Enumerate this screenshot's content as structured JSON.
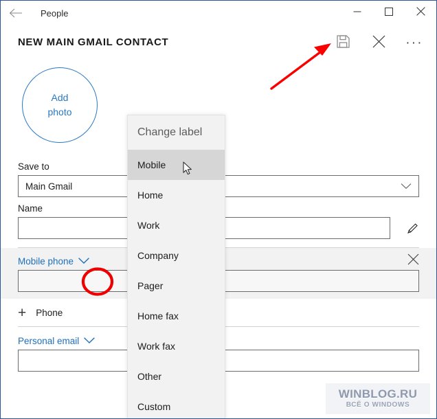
{
  "window": {
    "title": "People",
    "back_icon": "back-arrow-icon",
    "minimize": "–",
    "maximize": "□",
    "close": "✕"
  },
  "command_bar": {
    "page_title": "NEW MAIN GMAIL CONTACT",
    "save_icon": "save-floppy-icon",
    "cancel_icon": "close-x-icon",
    "more_icon": "more-ellipsis-icon",
    "more_glyph": "···"
  },
  "avatar": {
    "line1": "Add",
    "line2": "photo"
  },
  "form": {
    "save_to": {
      "label": "Save to",
      "value": "Main Gmail",
      "chevron": "chevron-down-icon"
    },
    "name": {
      "label": "Name",
      "value": "",
      "edit_icon": "pencil-edit-icon"
    },
    "mobile_phone": {
      "label": "Mobile phone",
      "chevron": "chevron-down-icon",
      "value": "",
      "remove_icon": "close-x-icon"
    },
    "add_phone": {
      "plus": "+",
      "label": "Phone"
    },
    "personal_email": {
      "label": "Personal email",
      "chevron": "chevron-down-icon",
      "value": ""
    }
  },
  "flyout": {
    "title": "Change label",
    "items": [
      {
        "label": "Mobile",
        "selected": true
      },
      {
        "label": "Home",
        "selected": false
      },
      {
        "label": "Work",
        "selected": false
      },
      {
        "label": "Company",
        "selected": false
      },
      {
        "label": "Pager",
        "selected": false
      },
      {
        "label": "Home fax",
        "selected": false
      },
      {
        "label": "Work fax",
        "selected": false
      },
      {
        "label": "Other",
        "selected": false
      },
      {
        "label": "Custom",
        "selected": false
      }
    ]
  },
  "annotations": {
    "arrow_color": "#fb0000",
    "circle_color": "#ee0000",
    "arrow_name": "red-arrow-pointing-to-save",
    "circle_name": "red-ellipse-around-label-chevron"
  },
  "watermark": {
    "line1": "WINBLOG.RU",
    "line2": "ВСЁ О WINDOWS"
  },
  "colors": {
    "accent_blue": "#1d6fbd",
    "window_border": "#2a5699",
    "row_shade": "#f2f2f2",
    "flyout_bg": "#f2f2f2",
    "flyout_selected": "#d6d6d6"
  }
}
